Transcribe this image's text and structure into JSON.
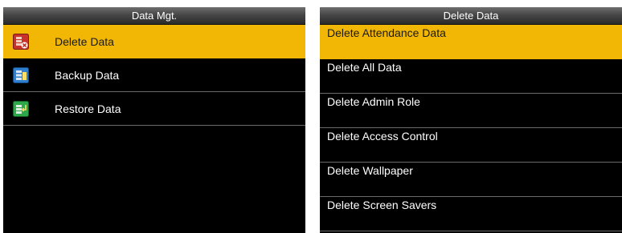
{
  "left_screen": {
    "title": "Data Mgt.",
    "items": [
      {
        "label": "Delete Data",
        "icon": "delete-data-icon",
        "selected": true
      },
      {
        "label": "Backup Data",
        "icon": "backup-data-icon",
        "selected": false
      },
      {
        "label": "Restore Data",
        "icon": "restore-data-icon",
        "selected": false
      }
    ]
  },
  "right_screen": {
    "title": "Delete Data",
    "items": [
      {
        "label": "Delete Attendance Data",
        "selected": true
      },
      {
        "label": "Delete All Data",
        "selected": false
      },
      {
        "label": "Delete Admin Role",
        "selected": false
      },
      {
        "label": "Delete Access Control",
        "selected": false
      },
      {
        "label": "Delete Wallpaper",
        "selected": false
      },
      {
        "label": "Delete Screen Savers",
        "selected": false
      }
    ]
  },
  "colors": {
    "selection": "#f2b705",
    "background": "#000000",
    "divider": "#6a6a6a"
  }
}
